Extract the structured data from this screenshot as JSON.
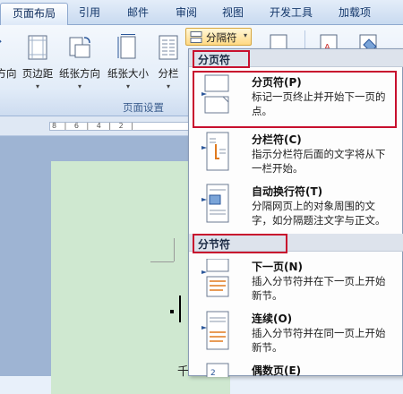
{
  "tabs": [
    {
      "label": "页面布局",
      "active": true
    },
    {
      "label": "引用",
      "active": false
    },
    {
      "label": "邮件",
      "active": false
    },
    {
      "label": "审阅",
      "active": false
    },
    {
      "label": "视图",
      "active": false
    },
    {
      "label": "开发工具",
      "active": false
    },
    {
      "label": "加载项",
      "active": false
    }
  ],
  "ribbon": {
    "buttons": [
      {
        "label": "方向",
        "icon": "text-direction-icon"
      },
      {
        "label": "页边距",
        "icon": "margins-icon"
      },
      {
        "label": "纸张方向",
        "icon": "orientation-icon"
      },
      {
        "label": "纸张大小",
        "icon": "page-size-icon"
      },
      {
        "label": "分栏",
        "icon": "columns-icon"
      }
    ],
    "group_label": "页面设置",
    "breaks_button": "分隔符"
  },
  "ruler": {
    "marks": "8 | 6 | 4 | 2 |"
  },
  "document": {
    "bottom_char": "千"
  },
  "menu": {
    "section_page": "分页符",
    "section_section": "分节符",
    "items": [
      {
        "title": "分页符(P)",
        "desc": "标记一页终止并开始下一页的点。",
        "icon": "page-break-icon"
      },
      {
        "title": "分栏符(C)",
        "desc": "指示分栏符后面的文字将从下一栏开始。",
        "icon": "column-break-icon"
      },
      {
        "title": "自动换行符(T)",
        "desc": "分隔网页上的对象周围的文字，如分隔题注文字与正文。",
        "icon": "text-wrapping-break-icon"
      },
      {
        "title": "下一页(N)",
        "desc": "插入分节符并在下一页上开始新节。",
        "icon": "next-page-section-icon"
      },
      {
        "title": "连续(O)",
        "desc": "插入分节符并在同一页上开始新节。",
        "icon": "continuous-section-icon"
      },
      {
        "title": "偶数页(E)",
        "desc": "",
        "icon": "even-page-section-icon"
      }
    ]
  },
  "colors": {
    "highlight_box": "#c8102e",
    "accent": "#15386b"
  }
}
